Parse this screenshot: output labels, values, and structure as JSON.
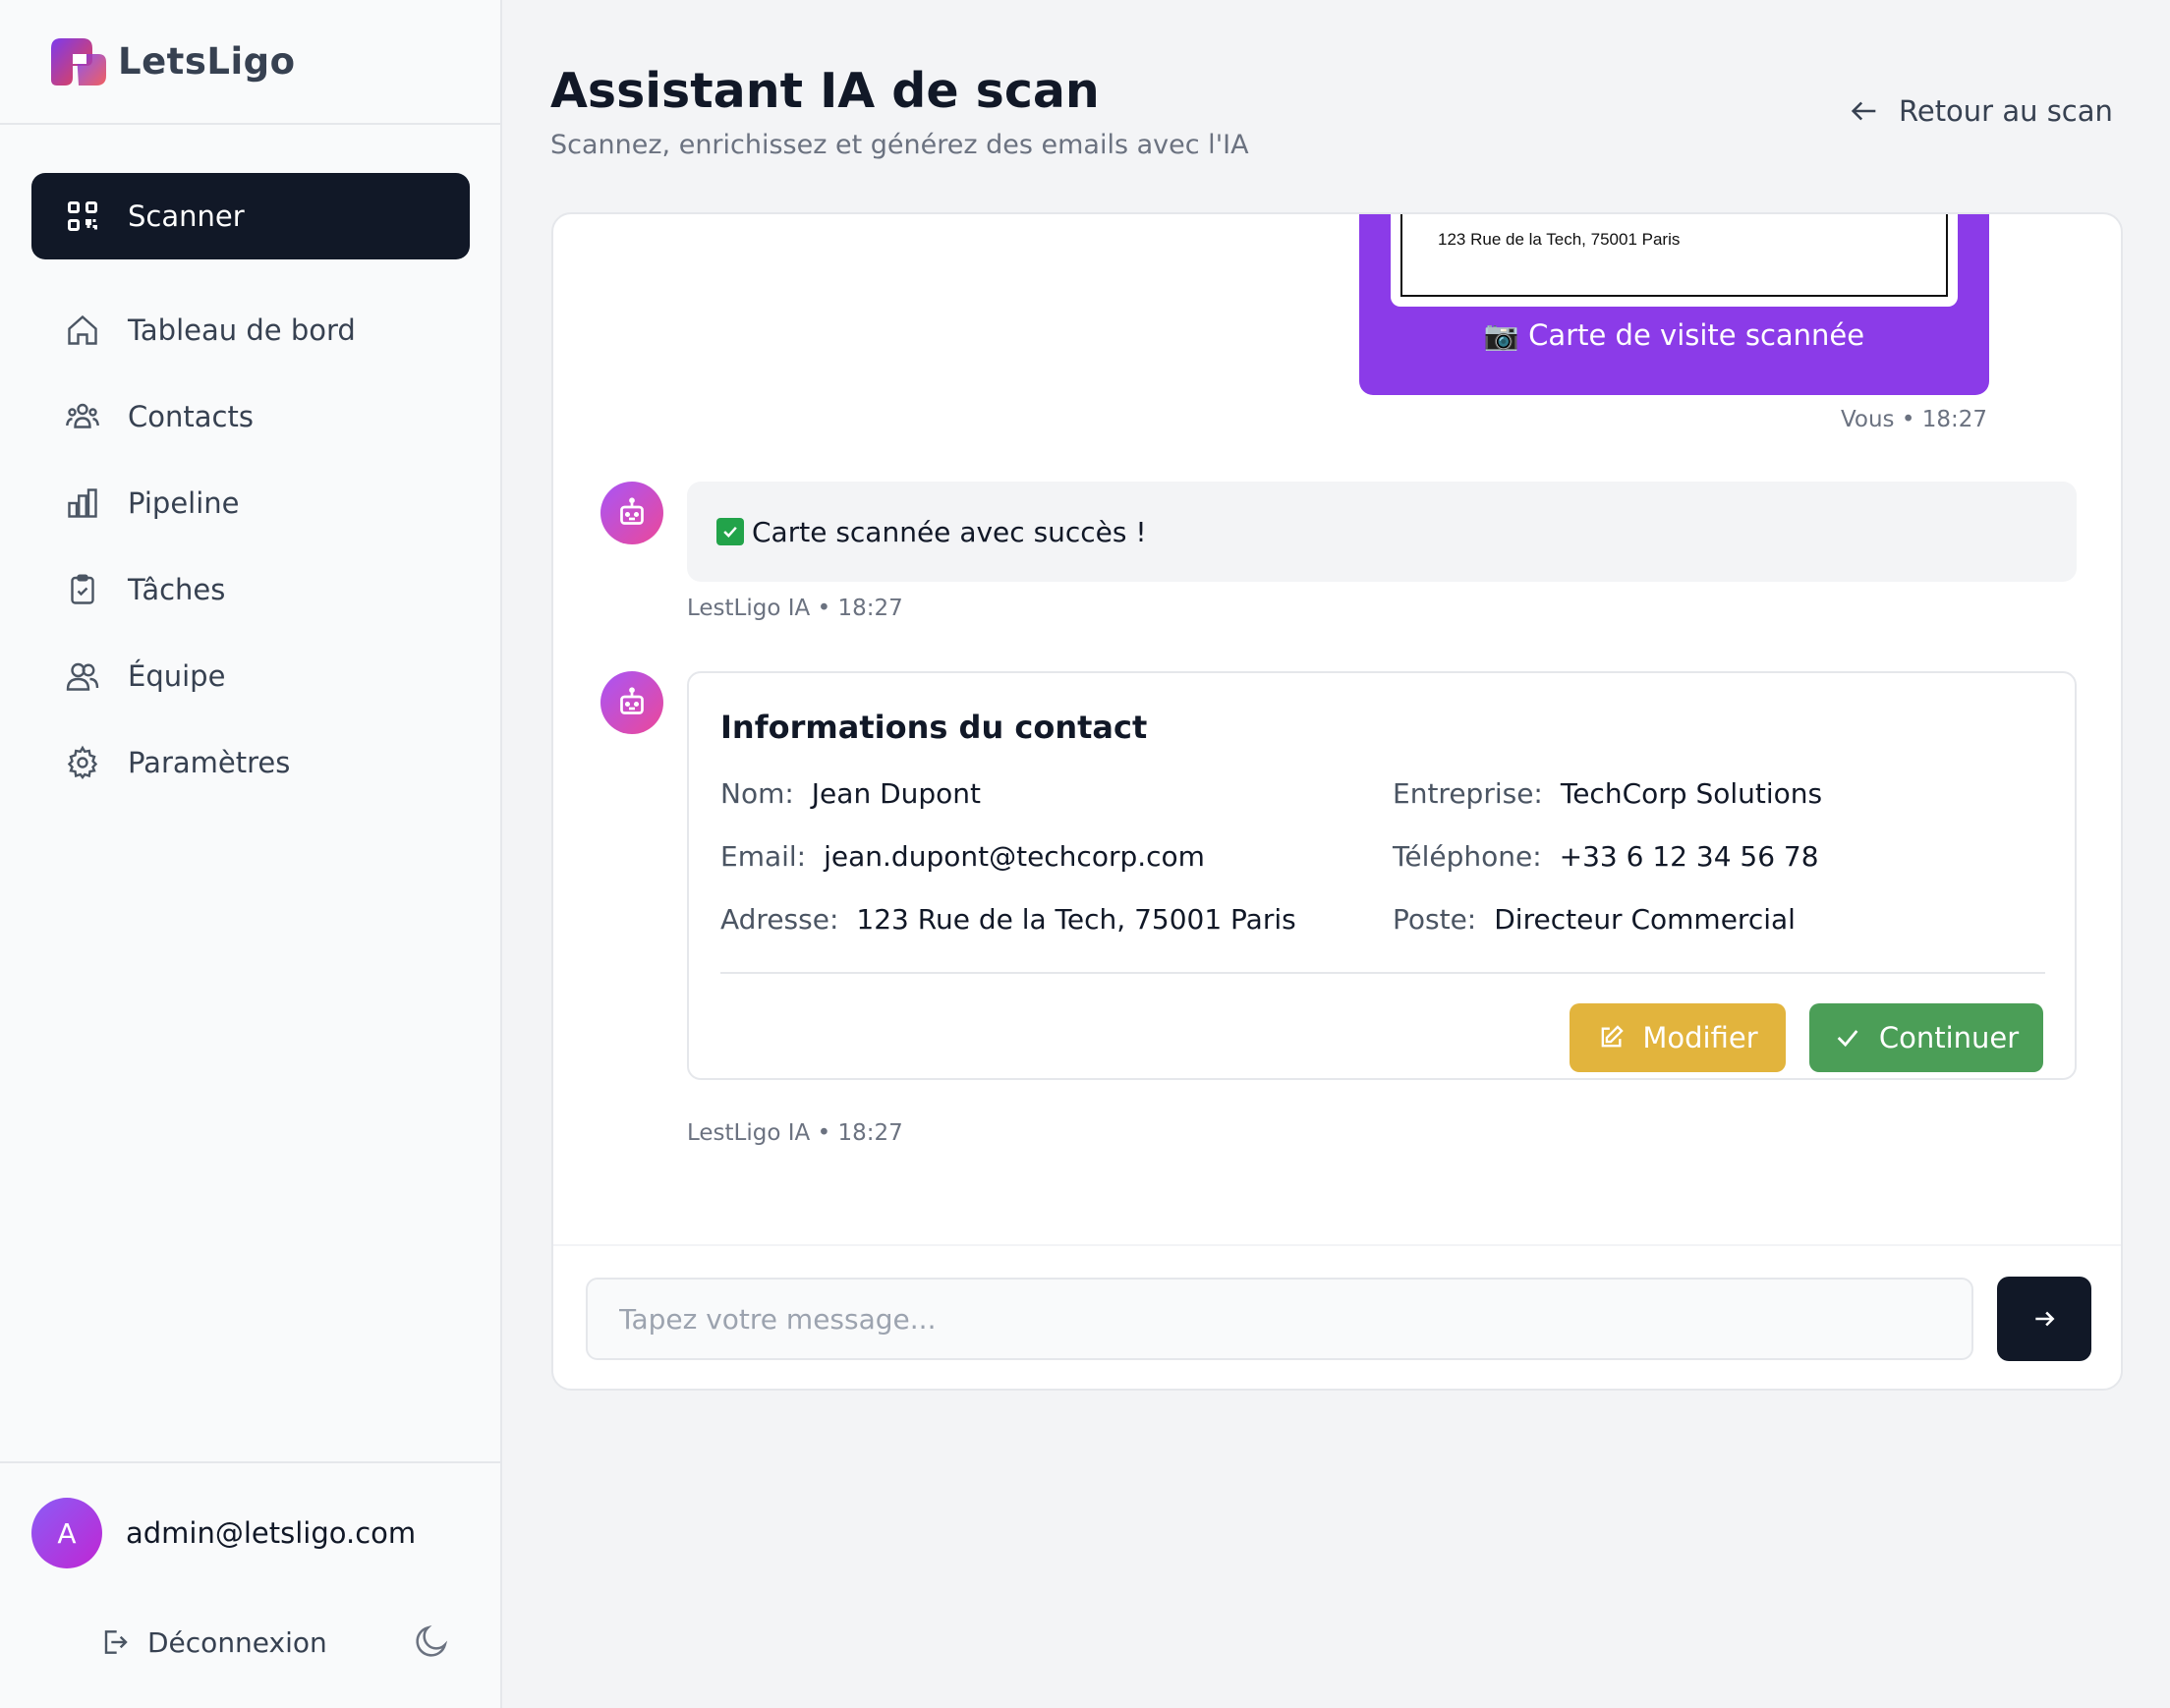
{
  "brand": {
    "name": "LetsLigo",
    "logo_gradient": [
      "#7c3aed",
      "#ef4444"
    ]
  },
  "sidebar": {
    "items": [
      {
        "label": "Scanner",
        "icon": "qr-scan-icon",
        "active": true
      },
      {
        "label": "Tableau de bord",
        "icon": "home-icon"
      },
      {
        "label": "Contacts",
        "icon": "users-icon"
      },
      {
        "label": "Pipeline",
        "icon": "bar-chart-icon"
      },
      {
        "label": "Tâches",
        "icon": "clipboard-check-icon"
      },
      {
        "label": "Équipe",
        "icon": "team-icon"
      },
      {
        "label": "Paramètres",
        "icon": "gear-icon"
      }
    ],
    "user": {
      "initial": "A",
      "email": "admin@letsligo.com"
    },
    "logout_label": "Déconnexion"
  },
  "header": {
    "title": "Assistant IA de scan",
    "subtitle": "Scannez, enrichissez et générez des emails avec l'IA",
    "back_label": "Retour au scan"
  },
  "chat": {
    "scan_message": {
      "card_address": "123 Rue de la Tech, 75001 Paris",
      "caption": "📷 Carte de visite scannée",
      "meta": "Vous • 18:27"
    },
    "bot_message_1": {
      "text": "Carte scannée avec succès !",
      "meta": "LestLigo IA • 18:27"
    },
    "contact_card": {
      "title": "Informations du contact",
      "fields": [
        {
          "label": "Nom:",
          "value": "Jean Dupont"
        },
        {
          "label": "Entreprise:",
          "value": "TechCorp Solutions"
        },
        {
          "label": "Email:",
          "value": "jean.dupont@techcorp.com"
        },
        {
          "label": "Téléphone:",
          "value": "+33 6 12 34 56 78"
        },
        {
          "label": "Adresse:",
          "value": "123 Rue de la Tech, 75001 Paris"
        },
        {
          "label": "Poste:",
          "value": "Directeur Commercial"
        }
      ],
      "modify_label": "Modifier",
      "continue_label": "Continuer",
      "meta": "LestLigo IA • 18:27"
    },
    "input_placeholder": "Tapez votre message..."
  },
  "colors": {
    "sidebar_active": "#111827",
    "scan_bubble": "#8b3be8",
    "modify_button": "#e2b43d",
    "continue_button": "#4b9e57",
    "avatar_gradient": [
      "#8b5cf6",
      "#c026d3"
    ]
  }
}
